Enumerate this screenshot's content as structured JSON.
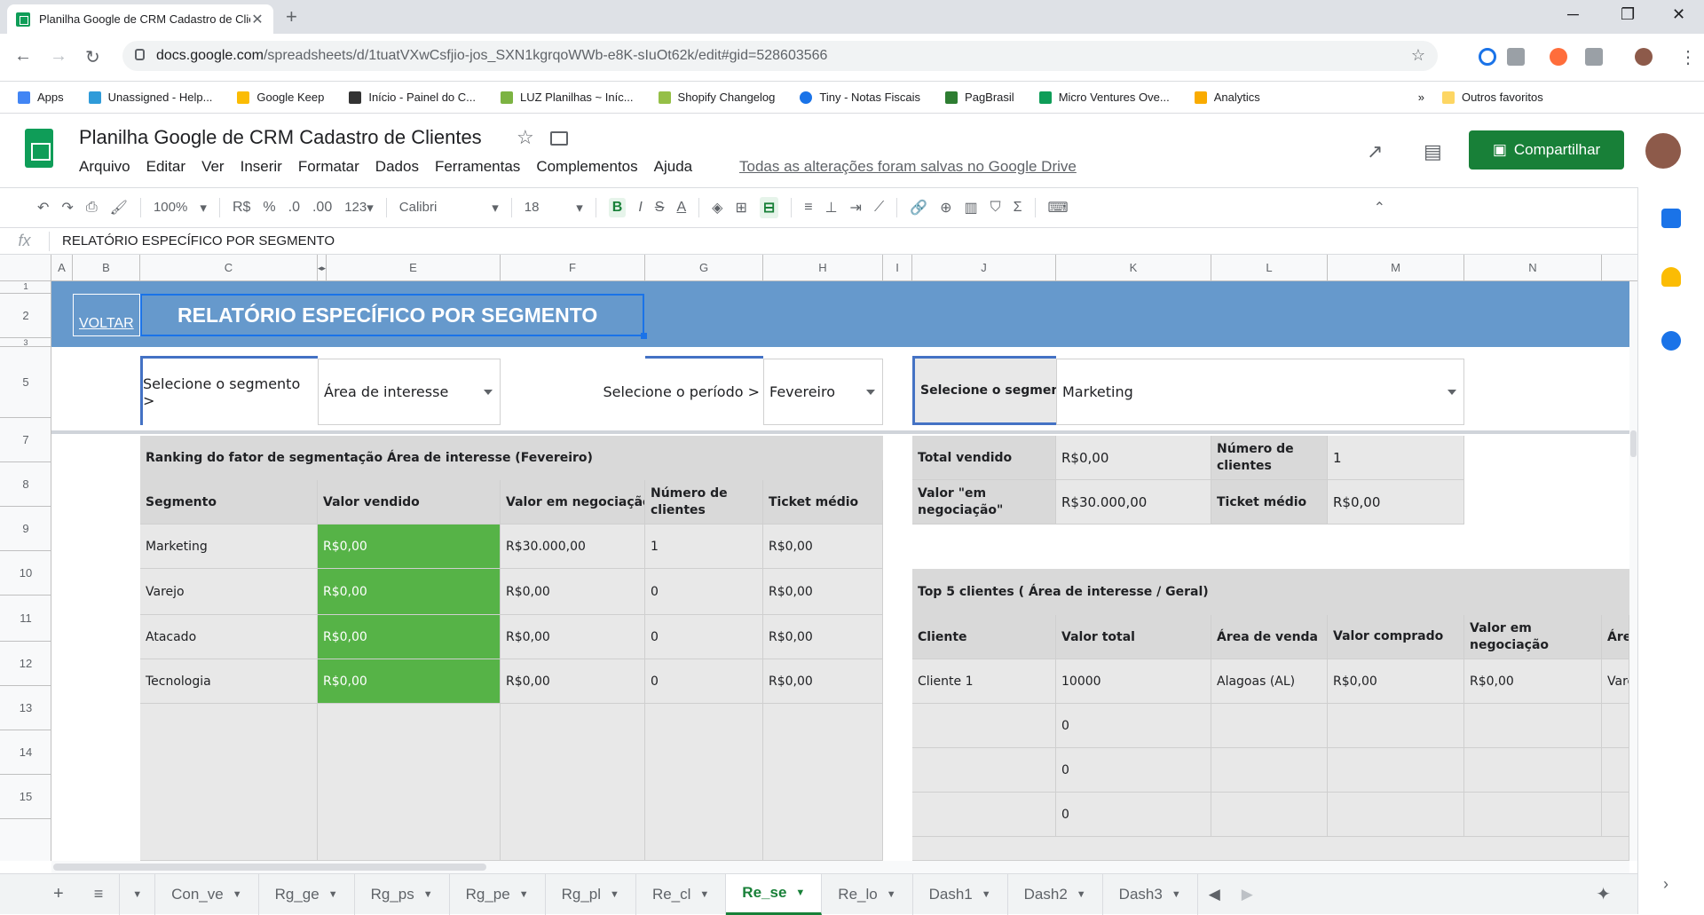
{
  "browser": {
    "tab_title": "Planilha Google de CRM Cadastro de Clientes",
    "url_host": "docs.google.com",
    "url_path": "/spreadsheets/d/1tuatVXwCsfjio-jos_SXN1kgrqoWWb-e8K-sIuOt62k/edit#gid=528603566",
    "bookmarks": [
      "Apps",
      "Unassigned - Help...",
      "Google Keep",
      "Início - Painel do C...",
      "LUZ Planilhas ~ Iníc...",
      "Shopify Changelog",
      "Tiny - Notas Fiscais",
      "PagBrasil",
      "Micro Ventures Ove...",
      "Analytics"
    ],
    "bookmarks_more": "»",
    "other_favorites": "Outros favoritos"
  },
  "sheets": {
    "title": "Planilha  Google de CRM Cadastro de Clientes",
    "menus": [
      "Arquivo",
      "Editar",
      "Ver",
      "Inserir",
      "Formatar",
      "Dados",
      "Ferramentas",
      "Complementos",
      "Ajuda"
    ],
    "saved_status": "Todas as alterações foram salvas no Google Drive",
    "share_label": "Compartilhar"
  },
  "toolbar": {
    "zoom": "100%",
    "currency": "R$",
    "percent": "%",
    "dec_less": ".0",
    "dec_more": ".00",
    "format_more": "123",
    "font": "Calibri",
    "font_size": "18"
  },
  "formula_bar": {
    "fx": "fx",
    "value": "RELATÓRIO ESPECÍFICO POR SEGMENTO"
  },
  "columns": [
    "A",
    "B",
    "C",
    "",
    "E",
    "F",
    "G",
    "H",
    "I",
    "J",
    "K",
    "L",
    "M",
    "N"
  ],
  "rows": [
    "1",
    "2",
    "3",
    "5",
    "7",
    "8",
    "9",
    "10",
    "11",
    "12",
    "13",
    "14",
    "15"
  ],
  "report": {
    "back_link": "VOLTAR",
    "title": "RELATÓRIO ESPECÍFICO POR SEGMENTO",
    "segment_label": "Selecione o segmento >",
    "segment_value": "Área de interesse",
    "period_label": "Selecione o período >",
    "period_value": "Fevereiro",
    "segment2_label": "Selecione o segmento",
    "segment2_value": "Marketing",
    "ranking_title": "Ranking do fator de segmentação Área de interesse (Fevereiro)",
    "ranking_headers": [
      "Segmento",
      "Valor vendido",
      "Valor em negociação",
      "Número de clientes",
      "Ticket médio"
    ],
    "ranking_rows": [
      [
        "Marketing",
        "R$0,00",
        "R$30.000,00",
        "1",
        "R$0,00"
      ],
      [
        "Varejo",
        "R$0,00",
        "R$0,00",
        "0",
        "R$0,00"
      ],
      [
        "Atacado",
        "R$0,00",
        "R$0,00",
        "0",
        "R$0,00"
      ],
      [
        "Tecnologia",
        "R$0,00",
        "R$0,00",
        "0",
        "R$0,00"
      ]
    ],
    "summary": {
      "total_vendido_label": "Total vendido",
      "total_vendido": "R$0,00",
      "num_clientes_label": "Número de clientes",
      "num_clientes": "1",
      "em_negociacao_label": "Valor \"em negociação\"",
      "em_negociacao": "R$30.000,00",
      "ticket_label": "Ticket médio",
      "ticket": "R$0,00"
    },
    "top5_title": "Top 5 clientes ( Área de interesse / Geral)",
    "top5_headers": [
      "Cliente",
      "Valor total",
      "Área de venda",
      "Valor comprado",
      "Valor em negociação",
      "Área"
    ],
    "top5_rows": [
      [
        "Cliente 1",
        "10000",
        "Alagoas (AL)",
        "R$0,00",
        "R$0,00",
        "Vare"
      ],
      [
        "",
        "0",
        "",
        "",
        "",
        ""
      ],
      [
        "",
        "0",
        "",
        "",
        "",
        ""
      ],
      [
        "",
        "0",
        "",
        "",
        "",
        ""
      ]
    ]
  },
  "sheet_tabs": [
    "Con_ve",
    "Rg_ge",
    "Rg_ps",
    "Rg_pe",
    "Rg_pl",
    "Re_cl",
    "Re_se",
    "Re_lo",
    "Dash1",
    "Dash2",
    "Dash3"
  ],
  "active_tab": "Re_se",
  "colors": {
    "banner": "#6699cc",
    "green_fill": "#56b347",
    "share_button": "#188038"
  }
}
